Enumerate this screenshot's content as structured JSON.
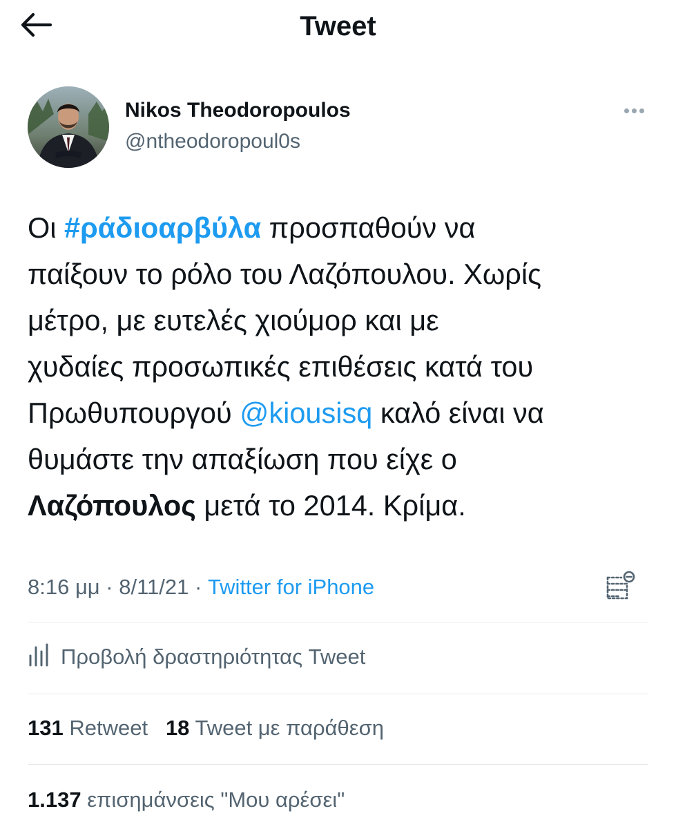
{
  "header": {
    "title": "Tweet",
    "back_icon": "arrow-left-icon"
  },
  "author": {
    "name": "Nikos Theodoropoulos",
    "handle": "@ntheodoropoul0s",
    "avatar": "avatar-photo-man-in-suit",
    "more_icon": "more-dots-icon"
  },
  "tweet": {
    "lines": [
      {
        "a": "Οι ",
        "hashtag": "#ράδιοαρβύλα",
        "b": " προσπαθούν να"
      },
      {
        "text": "παίξουν το ρόλο του Λαζόπουλου. Χωρίς"
      },
      {
        "text": "μέτρο, με ευτελές χιούμορ και με"
      },
      {
        "text": "χυδαίες προσωπικές επιθέσεις κατά του"
      },
      {
        "a": "Πρωθυπουργού ",
        "mention": "@kiousisq",
        "b": " καλό είναι να"
      },
      {
        "text": "θυμάστε την απαξίωση που είχε ο"
      },
      {
        "bold": "Λαζόπουλος",
        "b": " μετά το 2014. Κρίμα."
      }
    ]
  },
  "meta": {
    "time": "8:16 μμ",
    "separator": " · ",
    "date": "8/11/21",
    "source": "Twitter for iPhone",
    "notes_icon": "notes-icon"
  },
  "activity": {
    "label": "Προβολή δραστηριότητας Tweet",
    "icon": "bar-chart-icon"
  },
  "stats": {
    "retweets": {
      "count": "131",
      "label": "Retweet"
    },
    "quotes": {
      "count": "18",
      "label": "Tweet με παράθεση"
    },
    "likes": {
      "count": "1.137",
      "label": "επισημάνσεις \"Μου αρέσει\""
    }
  },
  "colors": {
    "link": "#1d9bf0",
    "secondary_text": "#536471",
    "primary_text": "#0f1419",
    "divider": "#e4e8eb"
  }
}
